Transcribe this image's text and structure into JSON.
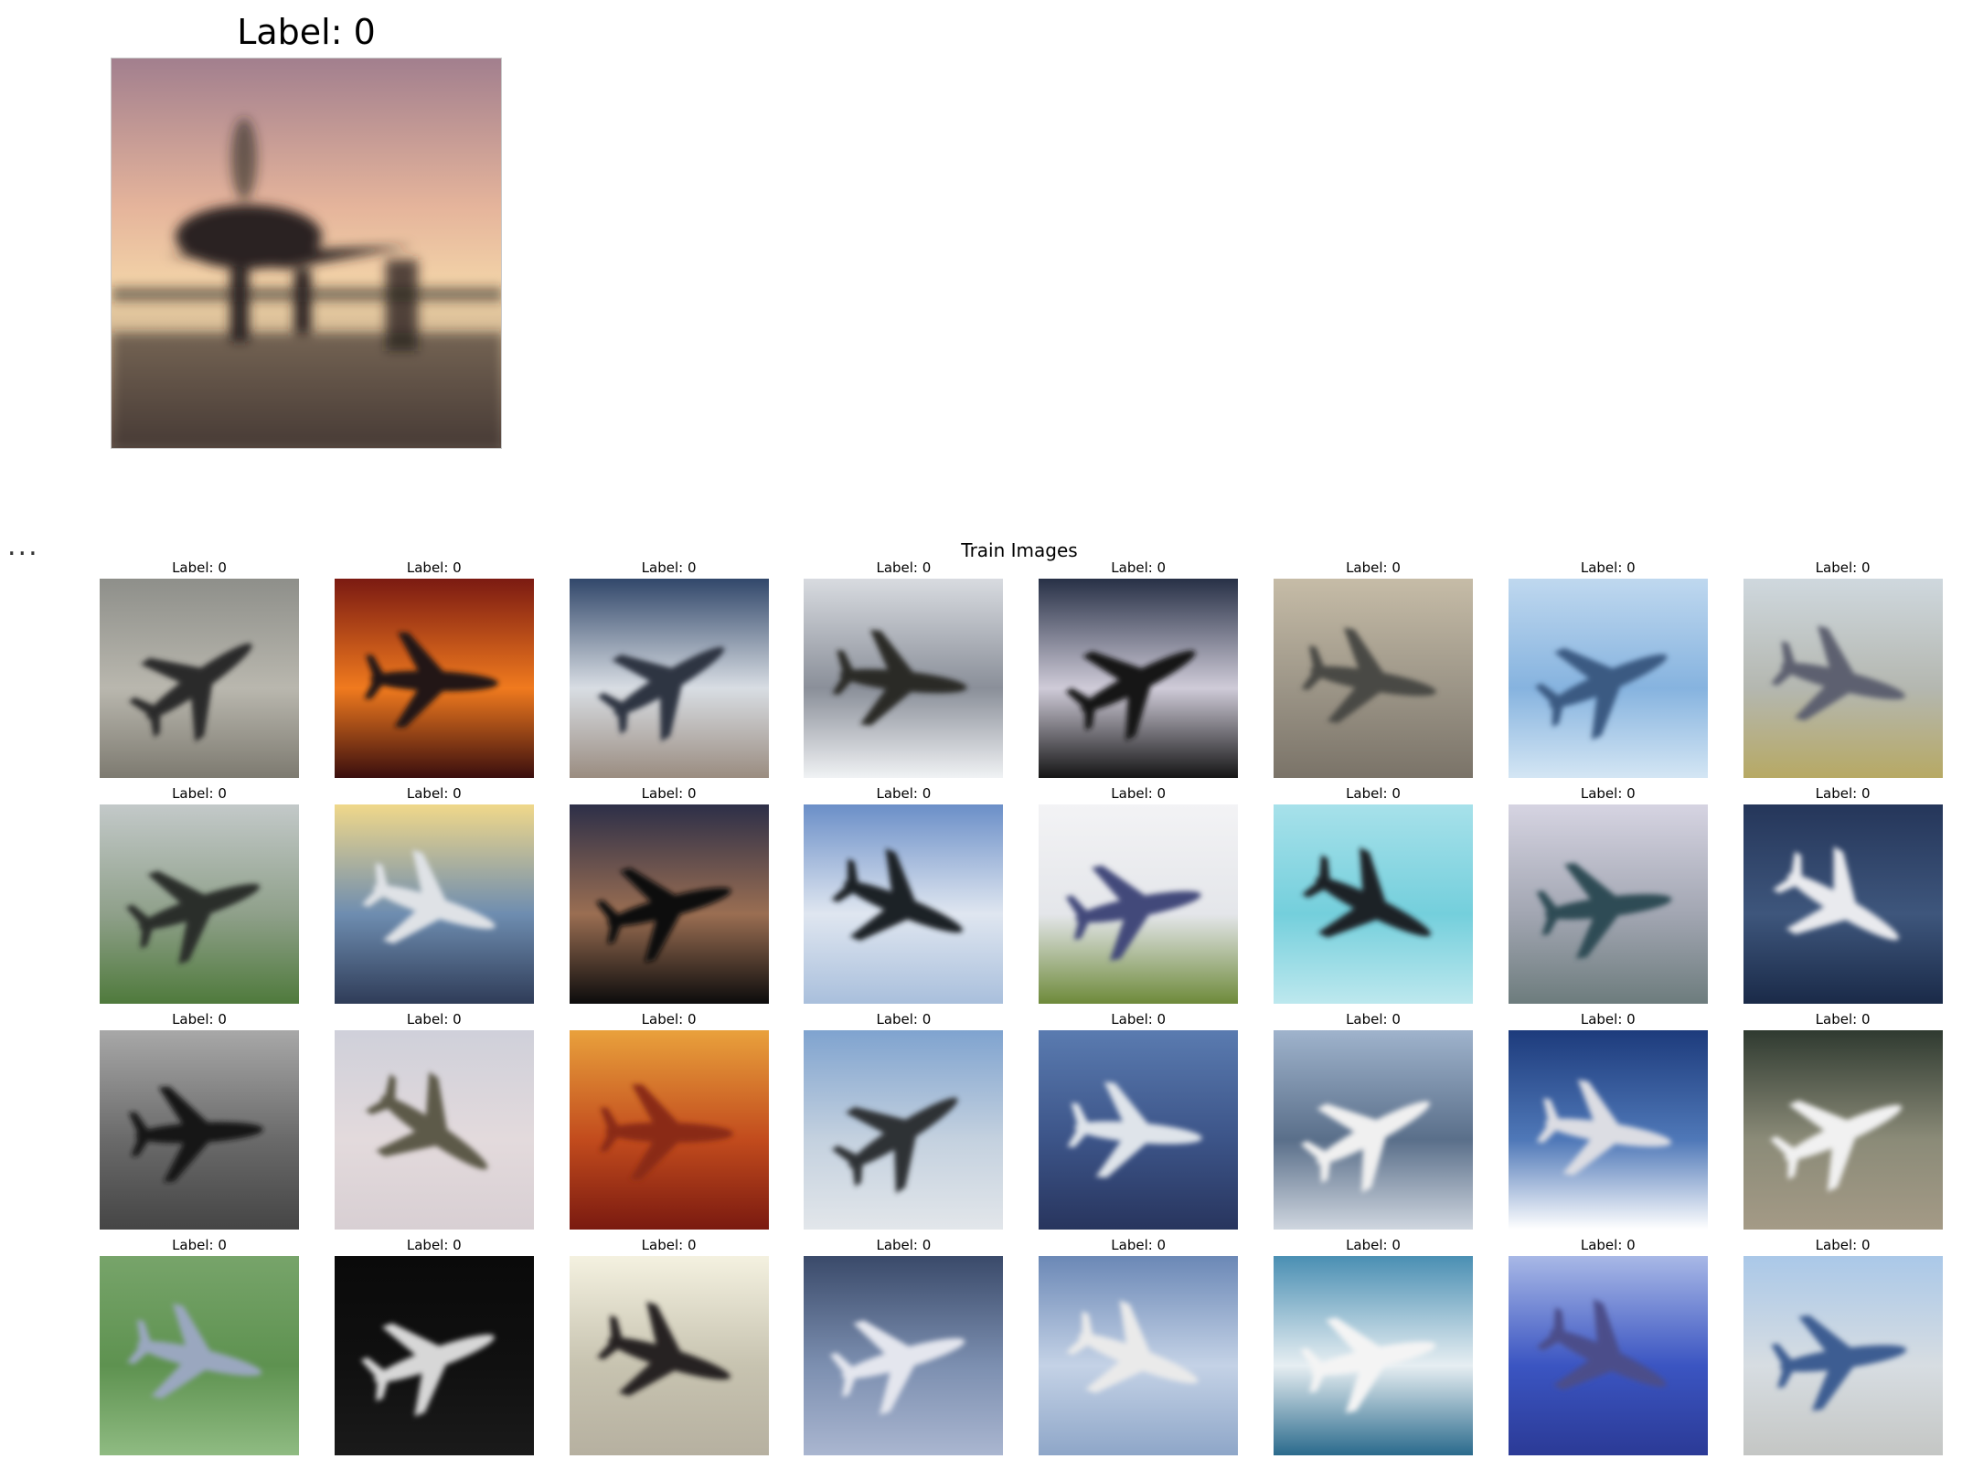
{
  "single": {
    "title": "Label: 0",
    "icon": "airplane-icon",
    "palette": {
      "sky_top": "#a27f8e",
      "sky_mid": "#e5b49b",
      "horizon": "#f4d6a9",
      "water": "#6b5a4f",
      "silhouette": "#2a2320"
    }
  },
  "ellipsis": "...",
  "grid": {
    "title": "Train Images",
    "items": [
      {
        "label": "Label: 0",
        "bg": [
          "#8e8f8a",
          "#b9b7ae",
          "#7d7a70"
        ],
        "plane": "#2b2a2a"
      },
      {
        "label": "Label: 0",
        "bg": [
          "#7b1a12",
          "#f07a1e",
          "#3a0e0e"
        ],
        "plane": "#241414"
      },
      {
        "label": "Label: 0",
        "bg": [
          "#31476a",
          "#d8dde3",
          "#9a8c80"
        ],
        "plane": "#2e3642"
      },
      {
        "label": "Label: 0",
        "bg": [
          "#d8dbe0",
          "#8a8f99",
          "#f0f2f4"
        ],
        "plane": "#2b2a26"
      },
      {
        "label": "Label: 0",
        "bg": [
          "#273046",
          "#cfcbd8",
          "#151515"
        ],
        "plane": "#121212"
      },
      {
        "label": "Label: 0",
        "bg": [
          "#c6bca7",
          "#9c9587",
          "#7a7368"
        ],
        "plane": "#4a4944"
      },
      {
        "label": "Label: 0",
        "bg": [
          "#bfd8ef",
          "#86b3df",
          "#d4e6f4"
        ],
        "plane": "#3b5a82"
      },
      {
        "label": "Label: 0",
        "bg": [
          "#cfd8de",
          "#b4b7b0",
          "#b7a964"
        ],
        "plane": "#5d6070"
      },
      {
        "label": "Label: 0",
        "bg": [
          "#c3c9c9",
          "#8fa08a",
          "#4f7a3c"
        ],
        "plane": "#2b2d2b"
      },
      {
        "label": "Label: 0",
        "bg": [
          "#f0d88a",
          "#6e8db0",
          "#2f3c58"
        ],
        "plane": "#dfe2e6"
      },
      {
        "label": "Label: 0",
        "bg": [
          "#2d2f48",
          "#9a6e52",
          "#0c0c0c"
        ],
        "plane": "#0e0e10"
      },
      {
        "label": "Label: 0",
        "bg": [
          "#6b8fc8",
          "#dfe6f0",
          "#a9bfdc"
        ],
        "plane": "#1f2226"
      },
      {
        "label": "Label: 0",
        "bg": [
          "#f3f3f5",
          "#e4e6ea",
          "#6e8a3a"
        ],
        "plane": "#424a7a"
      },
      {
        "label": "Label: 0",
        "bg": [
          "#a7e1ea",
          "#74cfdc",
          "#bde8ee"
        ],
        "plane": "#1e2128"
      },
      {
        "label": "Label: 0",
        "bg": [
          "#d6d4e2",
          "#a2a6b2",
          "#6d7c7d"
        ],
        "plane": "#2f4c55"
      },
      {
        "label": "Label: 0",
        "bg": [
          "#25365a",
          "#3e567c",
          "#1a2a48"
        ],
        "plane": "#e9eaee"
      },
      {
        "label": "Label: 0",
        "bg": [
          "#a8a8a8",
          "#6a6a6a",
          "#454545"
        ],
        "plane": "#161616"
      },
      {
        "label": "Label: 0",
        "bg": [
          "#cfd0da",
          "#e3dadc",
          "#d8cfd3"
        ],
        "plane": "#5d5a48"
      },
      {
        "label": "Label: 0",
        "bg": [
          "#e9a13c",
          "#c24b1d",
          "#7a1a10"
        ],
        "plane": "#8a2c15"
      },
      {
        "label": "Label: 0",
        "bg": [
          "#7fa3cf",
          "#c4d1df",
          "#e2e6ea"
        ],
        "plane": "#2f3236"
      },
      {
        "label": "Label: 0",
        "bg": [
          "#5a7bb0",
          "#3c5488",
          "#28355e"
        ],
        "plane": "#dfe4ea"
      },
      {
        "label": "Label: 0",
        "bg": [
          "#9fb3cc",
          "#5a6f8a",
          "#cfd6df"
        ],
        "plane": "#f0f0f0"
      },
      {
        "label": "Label: 0",
        "bg": [
          "#1d3b7c",
          "#4f78b8",
          "#ffffff"
        ],
        "plane": "#dcdde3"
      },
      {
        "label": "Label: 0",
        "bg": [
          "#2f3a30",
          "#8b8b78",
          "#a49a86"
        ],
        "plane": "#f1f1f1"
      },
      {
        "label": "Label: 0",
        "bg": [
          "#77a46a",
          "#5e9250",
          "#8fbb82"
        ],
        "plane": "#9aa7bf"
      },
      {
        "label": "Label: 0",
        "bg": [
          "#0a0a0a",
          "#101010",
          "#1a1a1a"
        ],
        "plane": "#d7d7d7"
      },
      {
        "label": "Label: 0",
        "bg": [
          "#f4f1e0",
          "#c7c3b0",
          "#b6b0a0"
        ],
        "plane": "#262421"
      },
      {
        "label": "Label: 0",
        "bg": [
          "#3a4a6a",
          "#7c8fb0",
          "#aab6d0"
        ],
        "plane": "#e4e6ee"
      },
      {
        "label": "Label: 0",
        "bg": [
          "#6b88b6",
          "#c4d2e6",
          "#8ea6c8"
        ],
        "plane": "#eaeaea"
      },
      {
        "label": "Label: 0",
        "bg": [
          "#4a8fb3",
          "#e6eef2",
          "#2a6a8c"
        ],
        "plane": "#f4f4f4"
      },
      {
        "label": "Label: 0",
        "bg": [
          "#a8b8e6",
          "#3b55c2",
          "#2b3a96"
        ],
        "plane": "#4b4e8a"
      },
      {
        "label": "Label: 0",
        "bg": [
          "#aac8e8",
          "#d7dde2",
          "#c4c6c4"
        ],
        "plane": "#3e5d92"
      }
    ]
  }
}
